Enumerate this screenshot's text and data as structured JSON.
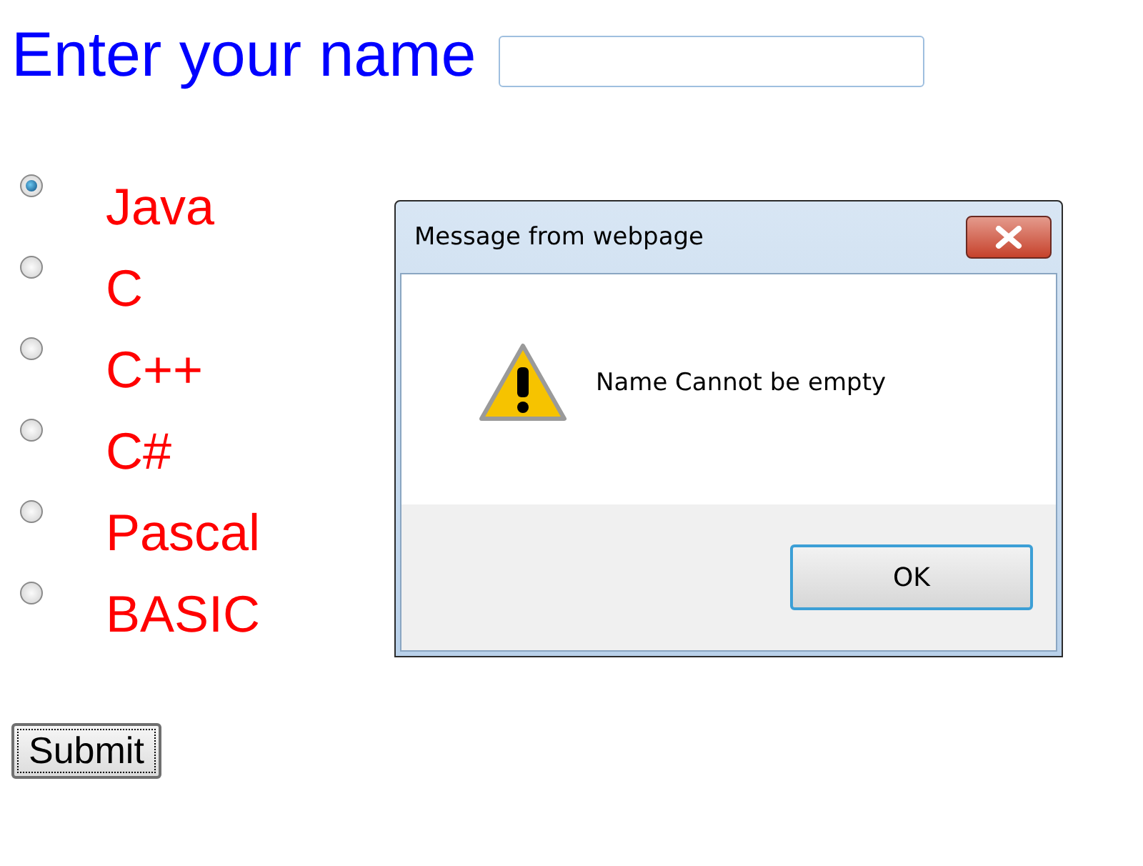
{
  "form": {
    "label": "Enter your name"
  },
  "languages": [
    {
      "label": "Java",
      "selected": true
    },
    {
      "label": "C",
      "selected": false
    },
    {
      "label": "C++",
      "selected": false
    },
    {
      "label": "C#",
      "selected": false
    },
    {
      "label": "Pascal",
      "selected": false
    },
    {
      "label": "BASIC",
      "selected": false
    }
  ],
  "submit": "Submit",
  "dialog": {
    "title": "Message from webpage",
    "message": "Name Cannot be empty",
    "buttons": [
      "OK"
    ]
  }
}
